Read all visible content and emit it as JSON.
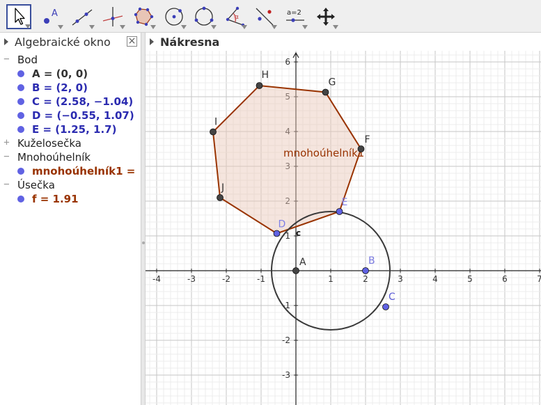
{
  "algebra": {
    "title": "Algebraické okno",
    "rows": [
      {
        "kind": "cat",
        "toggle": "−",
        "label": "Bod"
      },
      {
        "kind": "obj",
        "label": "A = (0, 0)",
        "color": "#333333"
      },
      {
        "kind": "obj",
        "label": "B = (2, 0)",
        "color": "#2b2bb0"
      },
      {
        "kind": "obj",
        "label": "C = (2.58, −1.04)",
        "color": "#2b2bb0"
      },
      {
        "kind": "obj",
        "label": "D = (−0.55, 1.07)",
        "color": "#2b2bb0"
      },
      {
        "kind": "obj",
        "label": "E = (1.25, 1.7)",
        "color": "#2b2bb0"
      },
      {
        "kind": "cat",
        "toggle": "+",
        "label": "Kuželosečka"
      },
      {
        "kind": "cat",
        "toggle": "−",
        "label": "Mnohoúhelník"
      },
      {
        "kind": "obj",
        "label": "mnohoúhelník1 =",
        "color": "#993300"
      },
      {
        "kind": "cat",
        "toggle": "−",
        "label": "Úsečka"
      },
      {
        "kind": "obj",
        "label": "f = 1.91",
        "color": "#993300"
      }
    ]
  },
  "graphics": {
    "title": "Nákresna",
    "x_ticks": [
      "-4",
      "-3",
      "-2",
      "-1",
      "1",
      "2",
      "3",
      "4",
      "5",
      "6",
      "7"
    ],
    "y_ticks": [
      "-3",
      "-2",
      "-1",
      "1",
      "2",
      "3",
      "4",
      "5",
      "6"
    ],
    "points": [
      {
        "name": "A",
        "x": 0,
        "y": 0,
        "fill": "#444444",
        "label_color": "#333333",
        "free": false
      },
      {
        "name": "B",
        "x": 2,
        "y": 0,
        "fill": "#6062e3",
        "label_color": "#7b7be0",
        "free": true
      },
      {
        "name": "C",
        "x": 2.58,
        "y": -1.04,
        "fill": "#6062e3",
        "label_color": "#5c5cd6",
        "free": true
      },
      {
        "name": "D",
        "x": -0.55,
        "y": 1.07,
        "fill": "#6062e3",
        "label_color": "#8080e6",
        "free": true
      },
      {
        "name": "E",
        "x": 1.25,
        "y": 1.7,
        "fill": "#6062e3",
        "label_color": "#8080e6",
        "free": true
      },
      {
        "name": "F",
        "x": 1.87,
        "y": 3.5,
        "fill": "#444444",
        "label_color": "#333333",
        "free": false
      },
      {
        "name": "G",
        "x": 0.85,
        "y": 5.13,
        "fill": "#444444",
        "label_color": "#333333",
        "free": false
      },
      {
        "name": "H",
        "x": -1.05,
        "y": 5.32,
        "fill": "#444444",
        "label_color": "#333333",
        "free": false
      },
      {
        "name": "I",
        "x": -2.38,
        "y": 3.99,
        "fill": "#444444",
        "label_color": "#333333",
        "free": false
      },
      {
        "name": "J",
        "x": -2.18,
        "y": 2.1,
        "fill": "#444444",
        "label_color": "#333333",
        "free": false
      }
    ],
    "polygon_order": [
      "D",
      "E",
      "F",
      "G",
      "H",
      "I",
      "J"
    ],
    "polygon_label": "mnohoúhelník1",
    "polygon_stroke": "#993300",
    "polygon_fill": "#e8c5b6",
    "circle_label": "c",
    "circle_label_pos": {
      "x": 0,
      "y": 1.12
    },
    "circle": {
      "center": {
        "x": 1,
        "y": 0
      },
      "radius": 1.7
    }
  },
  "toolbar": {
    "tools": [
      "move-tool",
      "point-tool",
      "line-tool",
      "perpendicular-tool",
      "polygon-tool",
      "circle-center-tool",
      "circle-three-points-tool",
      "angle-tool",
      "reflect-tool",
      "slider-tool",
      "move-graphics-tool"
    ],
    "slider_label": "a=2"
  }
}
